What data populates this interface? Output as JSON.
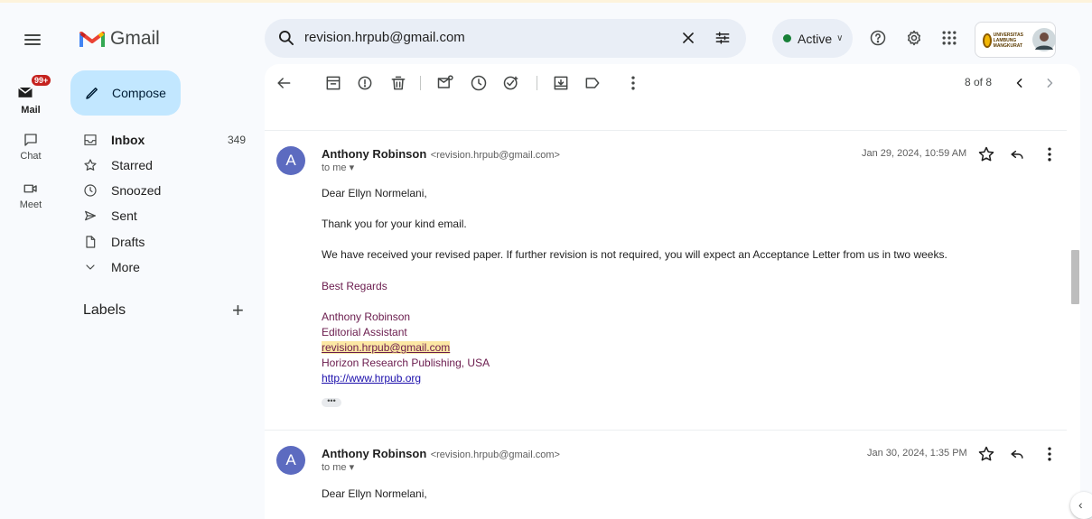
{
  "app": {
    "name": "Gmail"
  },
  "search": {
    "value": "revision.hrpub@gmail.com"
  },
  "status": {
    "label": "Active"
  },
  "account": {
    "org_logo_text": "UNIVERSITAS LAMBUNG MANGKURAT"
  },
  "rail": {
    "mail_label": "Mail",
    "mail_badge": "99+",
    "chat_label": "Chat",
    "meet_label": "Meet"
  },
  "sidebar": {
    "compose_label": "Compose",
    "items": [
      {
        "label": "Inbox",
        "count": "349",
        "icon": "inbox-icon"
      },
      {
        "label": "Starred",
        "count": "",
        "icon": "star-icon"
      },
      {
        "label": "Snoozed",
        "count": "",
        "icon": "clock-icon"
      },
      {
        "label": "Sent",
        "count": "",
        "icon": "send-icon"
      },
      {
        "label": "Drafts",
        "count": "",
        "icon": "draft-icon"
      },
      {
        "label": "More",
        "count": "",
        "icon": "chevron-down-icon"
      }
    ],
    "labels_title": "Labels",
    "labels_add": "+"
  },
  "toolbar": {
    "pager": "8 of 8"
  },
  "messages": [
    {
      "avatar_letter": "A",
      "sender_name": "Anthony Robinson",
      "sender_email": "<revision.hrpub@gmail.com>",
      "to": "to me",
      "date": "Jan 29, 2024, 10:59 AM",
      "greeting": "Dear Ellyn Normelani,",
      "line1": "Thank you for your kind email.",
      "line2": "We have received your revised paper. If further revision is not required, you will expect an Acceptance Letter from us in two weeks.",
      "closing": "Best Regards",
      "sig_name": "Anthony Robinson",
      "sig_title": "Editorial Assistant",
      "sig_email": "revision.hrpub@gmail.com",
      "sig_company": "Horizon Research Publishing, USA",
      "sig_url": "http://www.hrpub.org",
      "trimmed": "•••"
    },
    {
      "avatar_letter": "A",
      "sender_name": "Anthony Robinson",
      "sender_email": "<revision.hrpub@gmail.com>",
      "to": "to me",
      "date": "Jan 30, 2024, 1:35 PM",
      "greeting": "Dear Ellyn Normelani,"
    }
  ],
  "colors": {
    "compose_bg": "#c2e7ff",
    "active_green": "#188038",
    "badge_red": "#c5221f",
    "avatar_blue": "#5c6bc0",
    "signature": "#6a1b4d"
  }
}
